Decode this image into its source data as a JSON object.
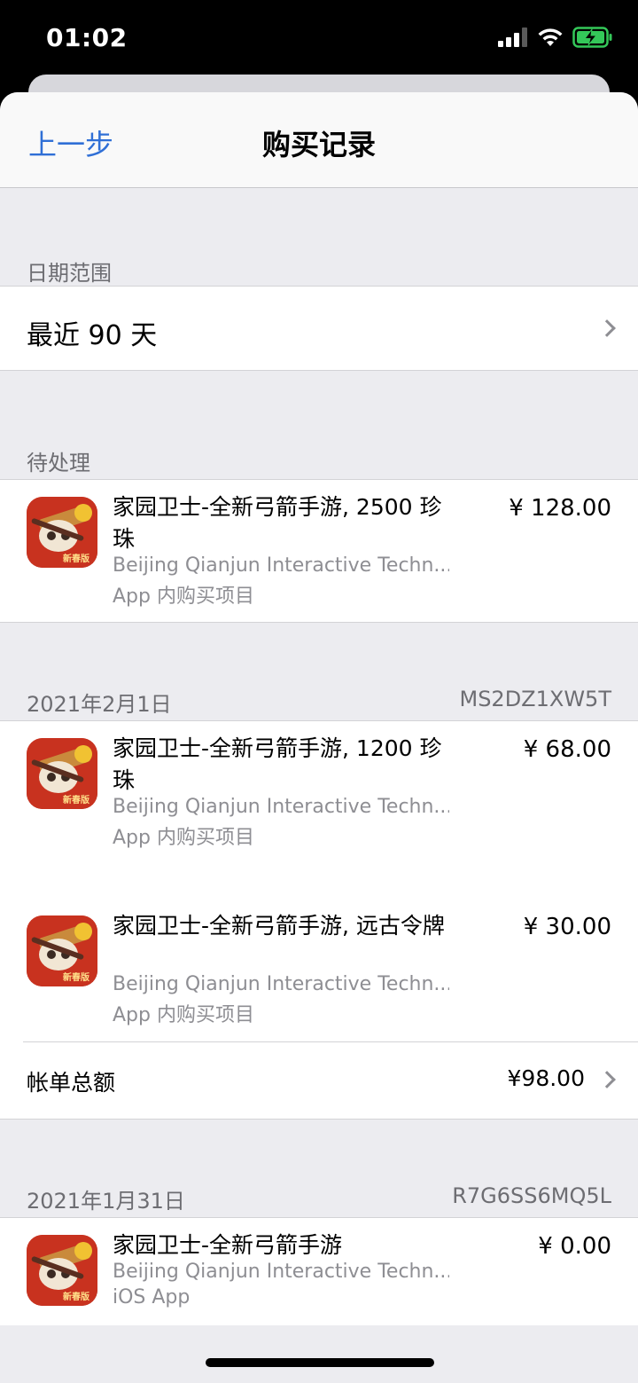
{
  "status_bar": {
    "time": "01:02"
  },
  "nav": {
    "back_label": "上一步",
    "title": "购买记录"
  },
  "date_range": {
    "header": "日期范围",
    "value": "最近 90 天"
  },
  "pending": {
    "header": "待处理",
    "items": [
      {
        "title": "家园卫士-全新弓箭手游, 2500 珍珠",
        "developer": "Beijing Qianjun Interactive Techn...",
        "kind": "App 内购买项目",
        "price": "¥ 128.00"
      }
    ]
  },
  "orders": [
    {
      "date": "2021年2月1日",
      "order_id": "MS2DZ1XW5T",
      "items": [
        {
          "title": "家园卫士-全新弓箭手游, 1200 珍珠",
          "developer": "Beijing Qianjun Interactive Techn...",
          "kind": "App 内购买项目",
          "price": "¥ 68.00"
        },
        {
          "title": "家园卫士-全新弓箭手游, 远古令牌",
          "developer": "Beijing Qianjun Interactive Techn...",
          "kind": "App 内购买项目",
          "price": "¥ 30.00"
        }
      ],
      "total_label": "帐单总额",
      "total_value": "¥98.00"
    },
    {
      "date": "2021年1月31日",
      "order_id": "R7G6SS6MQ5L",
      "items": [
        {
          "title": "家园卫士-全新弓箭手游",
          "developer": "Beijing Qianjun Interactive Techn...",
          "kind": "iOS App",
          "price": "¥ 0.00"
        }
      ]
    }
  ],
  "app_icon_badge": "新春版"
}
